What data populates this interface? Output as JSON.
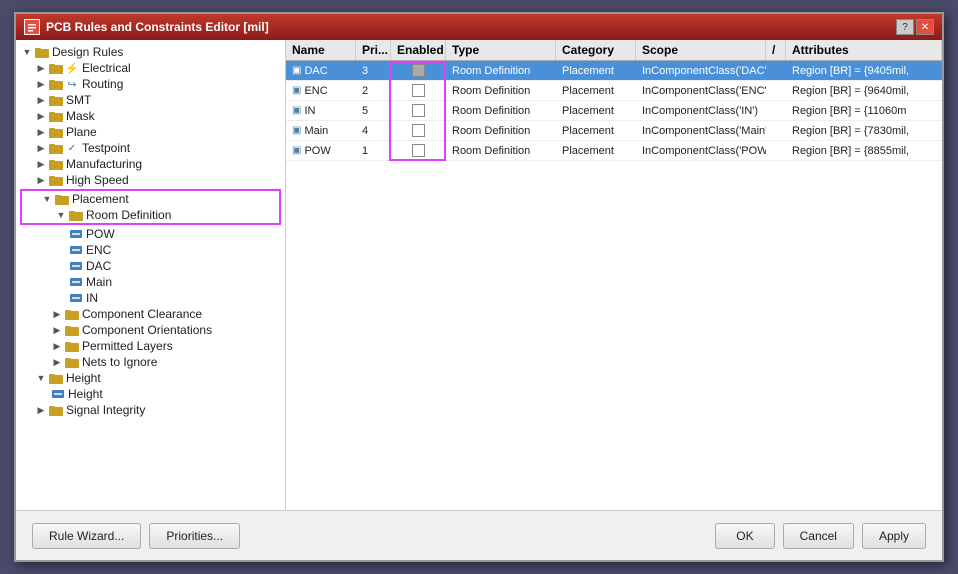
{
  "window": {
    "title": "PCB Rules and Constraints Editor [mil]",
    "icon": "pcb-icon"
  },
  "title_buttons": {
    "help": "?",
    "close": "✕"
  },
  "tree": {
    "items": [
      {
        "id": "design-rules",
        "label": "Design Rules",
        "level": 0,
        "type": "root",
        "expanded": true
      },
      {
        "id": "electrical",
        "label": "Electrical",
        "level": 1,
        "type": "folder",
        "expanded": false
      },
      {
        "id": "routing",
        "label": "Routing",
        "level": 1,
        "type": "folder",
        "expanded": false
      },
      {
        "id": "smt",
        "label": "SMT",
        "level": 1,
        "type": "folder",
        "expanded": false
      },
      {
        "id": "mask",
        "label": "Mask",
        "level": 1,
        "type": "folder",
        "expanded": false
      },
      {
        "id": "plane",
        "label": "Plane",
        "level": 1,
        "type": "folder",
        "expanded": false
      },
      {
        "id": "testpoint",
        "label": "Testpoint",
        "level": 1,
        "type": "folder",
        "expanded": false
      },
      {
        "id": "manufacturing",
        "label": "Manufacturing",
        "level": 1,
        "type": "folder",
        "expanded": false
      },
      {
        "id": "high-speed",
        "label": "High Speed",
        "level": 1,
        "type": "folder",
        "expanded": false
      },
      {
        "id": "placement",
        "label": "Placement",
        "level": 1,
        "type": "folder",
        "expanded": true,
        "highlighted": true
      },
      {
        "id": "room-definition",
        "label": "Room Definition",
        "level": 2,
        "type": "folder",
        "expanded": true,
        "highlighted": true
      },
      {
        "id": "pow",
        "label": "POW",
        "level": 3,
        "type": "rule"
      },
      {
        "id": "enc",
        "label": "ENC",
        "level": 3,
        "type": "rule"
      },
      {
        "id": "dac",
        "label": "DAC",
        "level": 3,
        "type": "rule"
      },
      {
        "id": "main",
        "label": "Main",
        "level": 3,
        "type": "rule"
      },
      {
        "id": "in",
        "label": "IN",
        "level": 3,
        "type": "rule"
      },
      {
        "id": "component-clearance",
        "label": "Component Clearance",
        "level": 2,
        "type": "folder",
        "expanded": false
      },
      {
        "id": "component-orientations",
        "label": "Component Orientations",
        "level": 2,
        "type": "folder",
        "expanded": false
      },
      {
        "id": "permitted-layers",
        "label": "Permitted Layers",
        "level": 2,
        "type": "folder",
        "expanded": false
      },
      {
        "id": "nets-to-ignore",
        "label": "Nets to Ignore",
        "level": 2,
        "type": "folder",
        "expanded": false
      },
      {
        "id": "height",
        "label": "Height",
        "level": 1,
        "type": "folder",
        "expanded": true
      },
      {
        "id": "height-rule",
        "label": "Height",
        "level": 2,
        "type": "rule"
      },
      {
        "id": "signal-integrity",
        "label": "Signal Integrity",
        "level": 1,
        "type": "folder",
        "expanded": false
      }
    ]
  },
  "table": {
    "columns": [
      {
        "id": "name",
        "label": "Name"
      },
      {
        "id": "priority",
        "label": "Pri..."
      },
      {
        "id": "enabled",
        "label": "Enabled"
      },
      {
        "id": "type",
        "label": "Type"
      },
      {
        "id": "category",
        "label": "Category"
      },
      {
        "id": "scope",
        "label": "Scope"
      },
      {
        "id": "slash",
        "label": "/"
      },
      {
        "id": "attributes",
        "label": "Attributes"
      }
    ],
    "rows": [
      {
        "name": "DAC",
        "priority": "3",
        "enabled": true,
        "type": "Room Definition",
        "category": "Placement",
        "scope": "InComponentClass('DAC')",
        "attributes": "Region [BR] = {9405mil,",
        "selected": true
      },
      {
        "name": "ENC",
        "priority": "2",
        "enabled": false,
        "type": "Room Definition",
        "category": "Placement",
        "scope": "InComponentClass('ENC')",
        "attributes": "Region [BR] = {9640mil,",
        "selected": false
      },
      {
        "name": "IN",
        "priority": "5",
        "enabled": false,
        "type": "Room Definition",
        "category": "Placement",
        "scope": "InComponentClass('IN')",
        "attributes": "Region [BR] = {11060m",
        "selected": false
      },
      {
        "name": "Main",
        "priority": "4",
        "enabled": false,
        "type": "Room Definition",
        "category": "Placement",
        "scope": "InComponentClass('Main')",
        "attributes": "Region [BR] = {7830mil,",
        "selected": false
      },
      {
        "name": "POW",
        "priority": "1",
        "enabled": false,
        "type": "Room Definition",
        "category": "Placement",
        "scope": "InComponentClass('POW')",
        "attributes": "Region [BR] = {8855mil,",
        "selected": false
      }
    ]
  },
  "buttons": {
    "rule_wizard": "Rule Wizard...",
    "priorities": "Priorities...",
    "ok": "OK",
    "cancel": "Cancel",
    "apply": "Apply"
  }
}
